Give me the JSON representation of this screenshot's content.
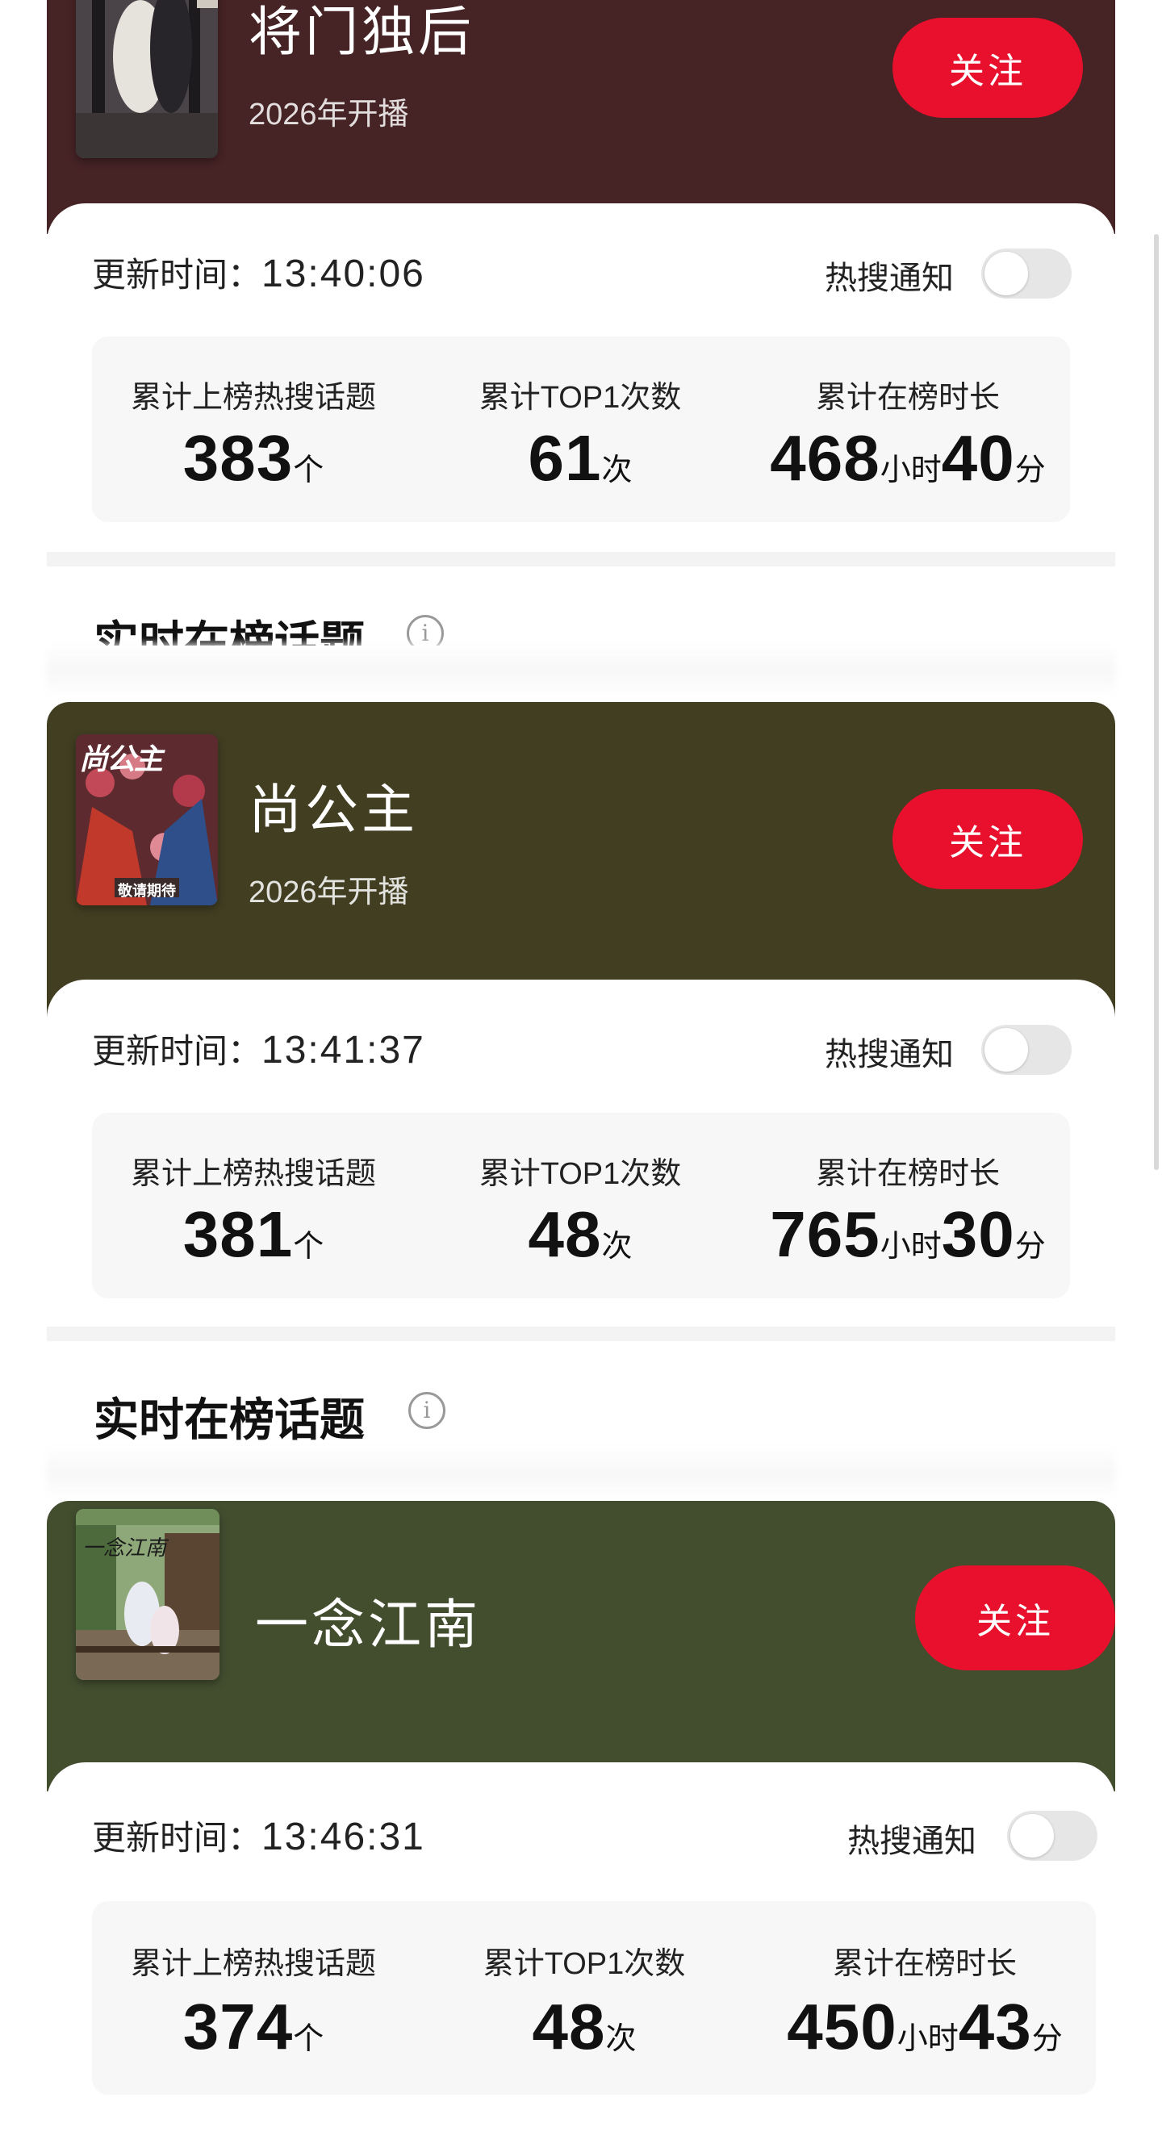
{
  "shows": [
    {
      "title": "将门独后",
      "subtitle": "2026年开播",
      "follow_label": "关注",
      "hero_color": "#462325",
      "update_label": "更新时间：",
      "update_time": "13:40:06",
      "notify_label": "热搜通知",
      "notify_on": false,
      "stats": {
        "topics_label": "累计上榜热搜话题",
        "topics_value": "383",
        "topics_unit": "个",
        "top1_label": "累计TOP1次数",
        "top1_value": "61",
        "top1_unit": "次",
        "duration_label": "累计在榜时长",
        "duration_hours": "468",
        "duration_hours_unit": "小时",
        "duration_minutes": "40",
        "duration_minutes_unit": "分"
      },
      "poster_icon": "poster-jiangmen"
    },
    {
      "title": "尚公主",
      "subtitle": "2026年开播",
      "follow_label": "关注",
      "hero_color": "#413e22",
      "update_label": "更新时间：",
      "update_time": "13:41:37",
      "notify_label": "热搜通知",
      "notify_on": false,
      "stats": {
        "topics_label": "累计上榜热搜话题",
        "topics_value": "381",
        "topics_unit": "个",
        "top1_label": "累计TOP1次数",
        "top1_value": "48",
        "top1_unit": "次",
        "duration_label": "累计在榜时长",
        "duration_hours": "765",
        "duration_hours_unit": "小时",
        "duration_minutes": "30",
        "duration_minutes_unit": "分"
      },
      "poster_icon": "poster-shanggongzhu",
      "poster_text": "尚公主",
      "poster_caption": "敬请期待"
    },
    {
      "title": "一念江南",
      "subtitle": "",
      "follow_label": "关注",
      "hero_color": "#434e2f",
      "update_label": "更新时间：",
      "update_time": "13:46:31",
      "notify_label": "热搜通知",
      "notify_on": false,
      "stats": {
        "topics_label": "累计上榜热搜话题",
        "topics_value": "374",
        "topics_unit": "个",
        "top1_label": "累计TOP1次数",
        "top1_value": "48",
        "top1_unit": "次",
        "duration_label": "累计在榜时长",
        "duration_hours": "450",
        "duration_hours_unit": "小时",
        "duration_minutes": "43",
        "duration_minutes_unit": "分"
      },
      "poster_icon": "poster-yinianjiangnan",
      "poster_text": "一念江南"
    }
  ],
  "sections": {
    "realtime_title_partial": "实时在榜话题",
    "realtime_title": "实时在榜话题",
    "info_icon": "info-icon"
  },
  "colors": {
    "follow_button": "#e8102c",
    "toggle_off": "#e6e6e6"
  }
}
